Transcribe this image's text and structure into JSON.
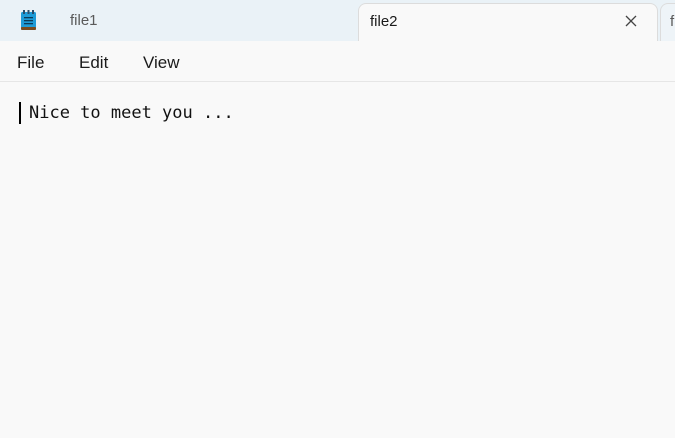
{
  "app": {
    "icon": "notepad-icon"
  },
  "tabs": [
    {
      "label": "file1",
      "active": false
    },
    {
      "label": "file2",
      "active": true
    },
    {
      "label": "f",
      "active": false
    }
  ],
  "close_icon": "close-icon",
  "menu": {
    "file": "File",
    "edit": "Edit",
    "view": "View"
  },
  "editor": {
    "content": "Nice to meet you ..."
  },
  "colors": {
    "tabstrip_bg": "#eaf2f7",
    "editor_bg": "#f9f9f9"
  }
}
